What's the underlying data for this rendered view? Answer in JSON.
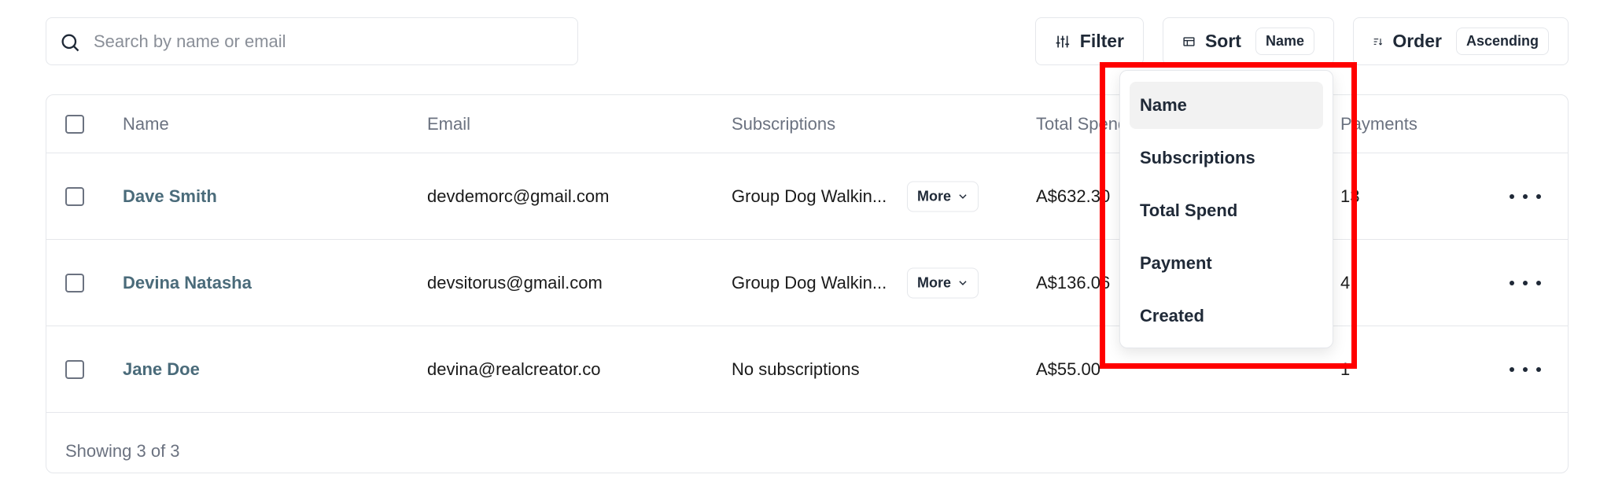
{
  "search": {
    "placeholder": "Search by name or email",
    "value": ""
  },
  "toolbar": {
    "filter_label": "Filter",
    "sort_label": "Sort",
    "sort_value": "Name",
    "order_label": "Order",
    "order_value": "Ascending"
  },
  "table": {
    "columns": [
      "Name",
      "Email",
      "Subscriptions",
      "Total Spend",
      "Payments"
    ],
    "rows": [
      {
        "name": "Dave Smith",
        "email": "devdemorc@gmail.com",
        "subscriptions": "Group Dog Walkin...",
        "more_label": "More",
        "total_spend": "A$632.30",
        "payments": "13"
      },
      {
        "name": "Devina Natasha",
        "email": "devsitorus@gmail.com",
        "subscriptions": "Group Dog Walkin...",
        "more_label": "More",
        "total_spend": "A$136.06",
        "payments": "4"
      },
      {
        "name": "Jane Doe",
        "email": "devina@realcreator.co",
        "subscriptions": "No subscriptions",
        "more_label": "",
        "total_spend": "A$55.00",
        "payments": "1"
      }
    ],
    "footer": "Showing 3 of 3"
  },
  "sort_dropdown": {
    "options": [
      "Name",
      "Subscriptions",
      "Total Spend",
      "Payment",
      "Created"
    ],
    "selected": "Name"
  },
  "colors": {
    "highlight": "#ff0000",
    "name_link": "#4a6b7a"
  }
}
